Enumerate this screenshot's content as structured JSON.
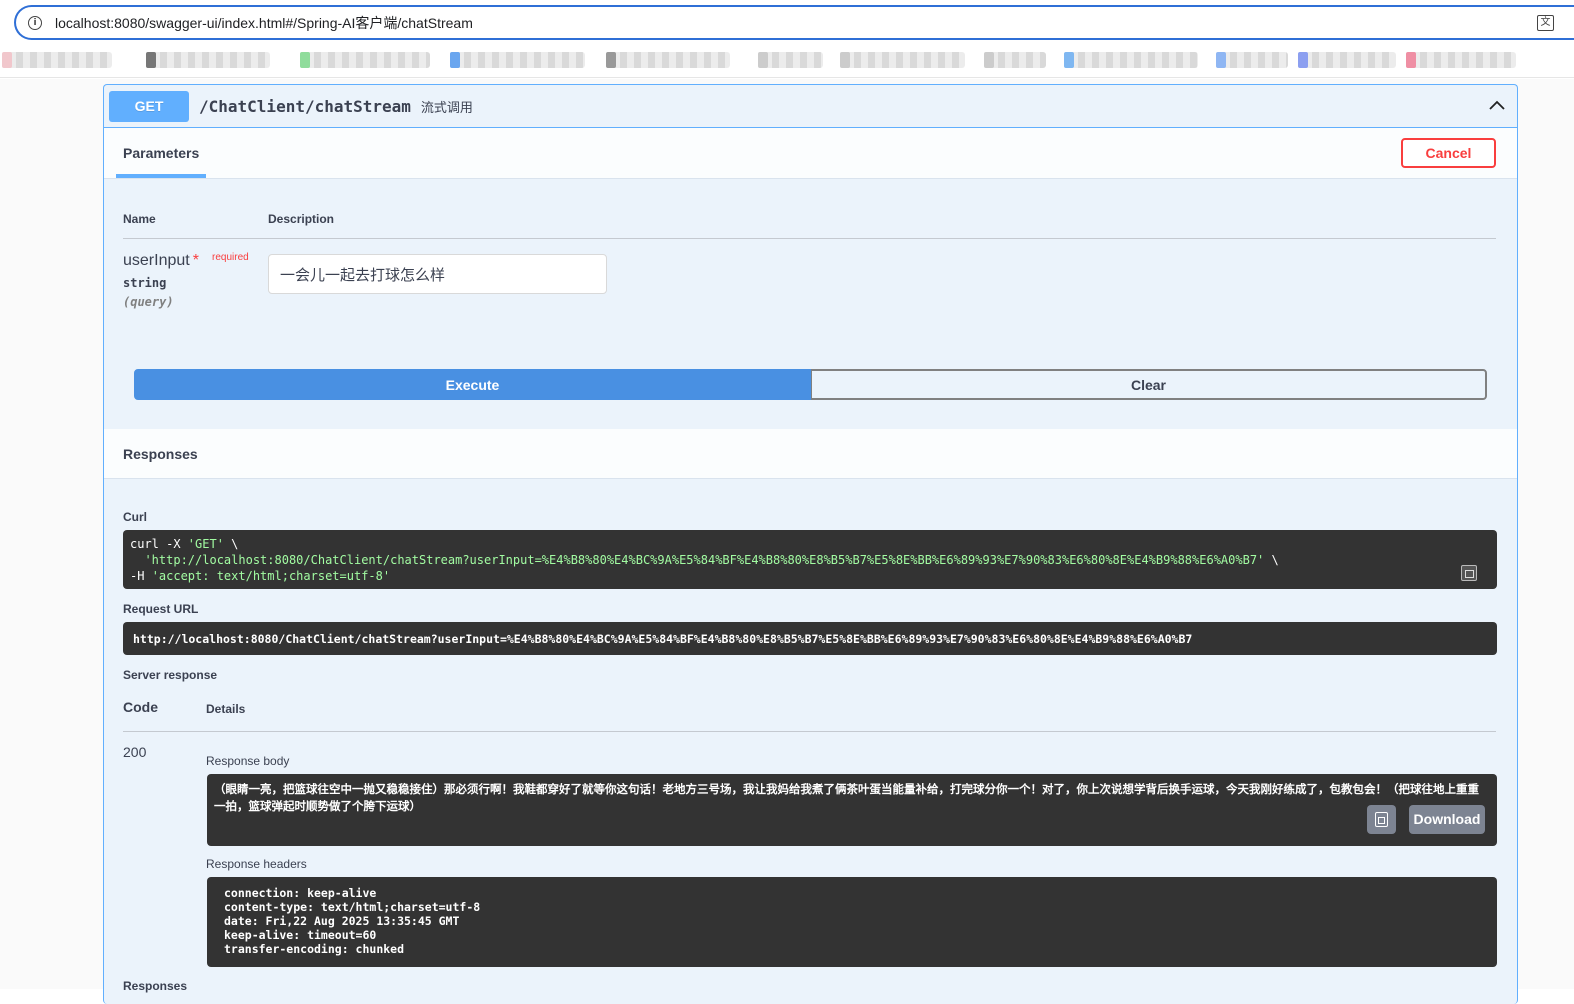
{
  "browser": {
    "url": "localhost:8080/swagger-ui/index.html#/Spring-AI客户端/chatStream"
  },
  "operation": {
    "method": "GET",
    "path": "/ChatClient/chatStream",
    "description": "流式调用"
  },
  "tabs": {
    "parameters_label": "Parameters",
    "cancel_label": "Cancel"
  },
  "params": {
    "name_header": "Name",
    "description_header": "Description",
    "items": [
      {
        "name": "userInput",
        "required_mark": "*",
        "required_label": "required",
        "type": "string",
        "in": "(query)",
        "value": "一会儿一起去打球怎么样"
      }
    ]
  },
  "actions": {
    "execute_label": "Execute",
    "clear_label": "Clear"
  },
  "responses": {
    "title": "Responses",
    "curl_label": "Curl",
    "curl": {
      "line1_cmd": "curl -X ",
      "line1_method": "'GET'",
      "line1_end": " \\",
      "line2_url": "'http://localhost:8080/ChatClient/chatStream?userInput=%E4%B8%80%E4%BC%9A%E5%84%BF%E4%B8%80%E8%B5%B7%E5%8E%BB%E6%89%93%E7%90%83%E6%80%8E%E4%B9%88%E6%A0%B7'",
      "line2_end": " \\",
      "line3_flag": "  -H ",
      "line3_header": "'accept: text/html;charset=utf-8'"
    },
    "request_url_label": "Request URL",
    "request_url": "http://localhost:8080/ChatClient/chatStream?userInput=%E4%B8%80%E4%BC%9A%E5%84%BF%E4%B8%80%E8%B5%B7%E5%8E%BB%E6%89%93%E7%90%83%E6%80%8E%E4%B9%88%E6%A0%B7",
    "server_response_label": "Server response",
    "code_header": "Code",
    "details_header": "Details",
    "status_code": "200",
    "response_body_label": "Response body",
    "response_body": "（眼睛一亮，把篮球往空中一抛又稳稳接住）那必须行啊！我鞋都穿好了就等你这句话！老地方三号场，我让我妈给我煮了俩茶叶蛋当能量补给，打完球分你一个！对了，你上次说想学背后换手运球，今天我刚好练成了，包教包会！（把球往地上重重一拍，篮球弹起时顺势做了个胯下运球）",
    "download_label": "Download",
    "response_headers_label": "Response headers",
    "response_headers": "connection: keep-alive\ncontent-type: text/html;charset=utf-8\ndate: Fri,22 Aug 2025 13:35:45 GMT\nkeep-alive: timeout=60\ntransfer-encoding: chunked",
    "next_label": "Responses"
  },
  "colors": {
    "get_accent": "#61affe",
    "execute": "#4990e2",
    "cancel": "#f93e3e",
    "code_bg": "#333333",
    "curl_string": "#a2fca2"
  }
}
